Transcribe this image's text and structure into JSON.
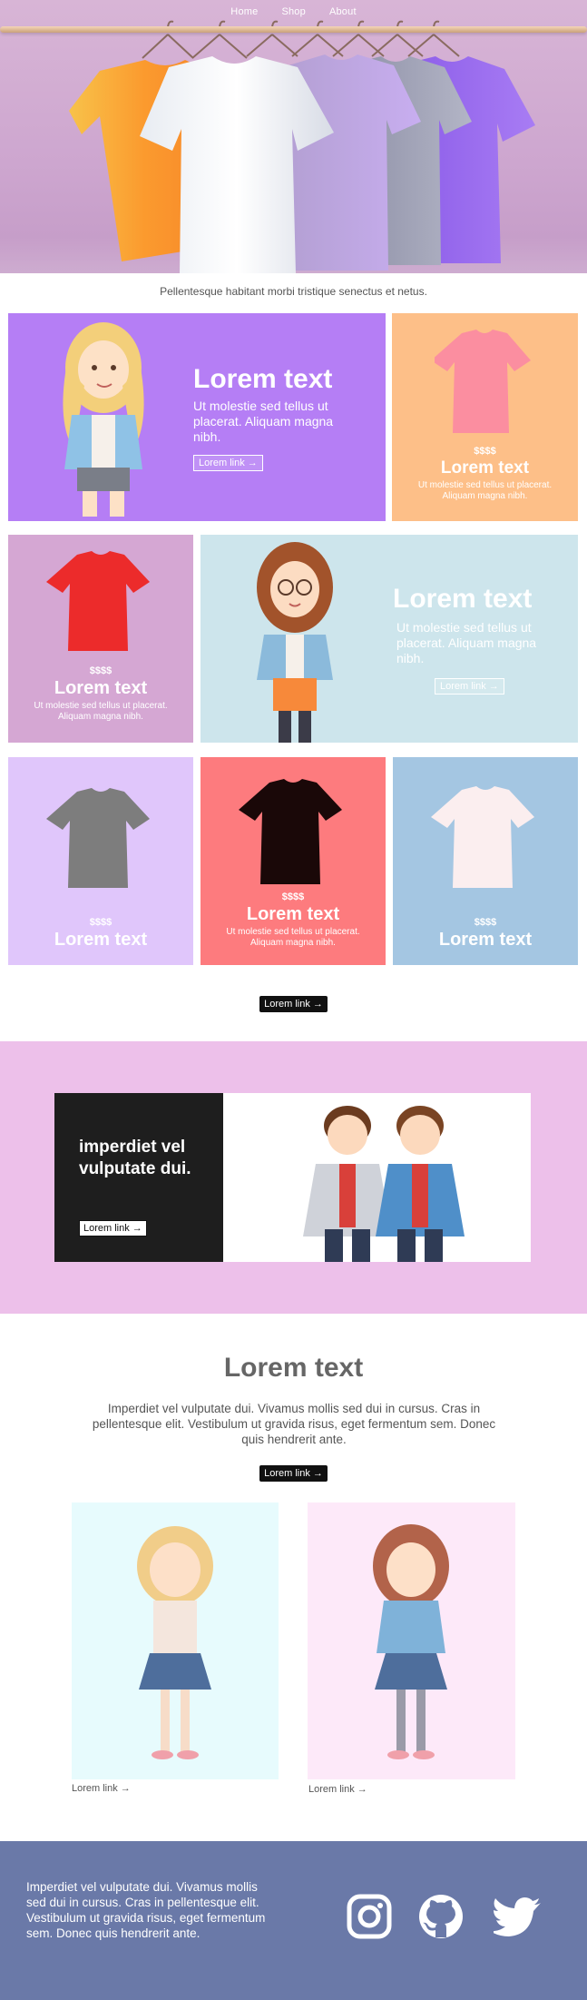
{
  "nav": {
    "items": [
      "Home",
      "Shop",
      "About"
    ]
  },
  "tagline": "Pellentesque habitant morbi tristique senectus et netus.",
  "feature_card_1": {
    "title": "Lorem text",
    "body": "Ut molestie sed tellus ut placerat. Aliquam magna nibh.",
    "link": "Lorem link →",
    "bg": "#b57ef5"
  },
  "product_card_peach": {
    "price": "$$$$",
    "title": "Lorem text",
    "body": "Ut molestie sed tellus ut placerat. Aliquam magna nibh.",
    "bg": "#fdbf88"
  },
  "product_card_red": {
    "price": "$$$$",
    "title": "Lorem text",
    "body": "Ut molestie sed tellus ut placerat. Aliquam magna nibh.",
    "bg": "#d5a7d3"
  },
  "feature_card_2": {
    "title": "Lorem text",
    "body": "Ut molestie sed tellus ut placerat. Aliquam magna nibh.",
    "link": "Lorem link →",
    "bg": "#cde5ec"
  },
  "product_card_gray": {
    "price": "$$$$",
    "title": "Lorem text",
    "bg": "#e0c6fb"
  },
  "product_card_black": {
    "price": "$$$$",
    "title": "Lorem text",
    "body": "Ut molestie sed tellus ut placerat. Aliquam magna nibh.",
    "bg": "#fd7b7e"
  },
  "product_card_white": {
    "price": "$$$$",
    "title": "Lorem text",
    "bg": "#a4c6e2"
  },
  "grid_link": "Lorem link →",
  "banner": {
    "title": "imperdiet vel vulputate dui.",
    "link": "Lorem link →"
  },
  "section": {
    "title": "Lorem text",
    "body": "Imperdiet vel vulputate dui. Vivamus mollis sed dui in cursus. Cras in pellentesque elit. Vestibulum ut gravida risus, eget fermentum sem. Donec quis hendrerit ante.",
    "link": "Lorem link →",
    "card_left_link": "Lorem link →",
    "card_right_link": "Lorem link →"
  },
  "footer": {
    "text": "Imperdiet vel vulputate dui. Vivamus mollis sed dui in cursus. Cras in pellentesque elit. Vestibulum ut gravida risus, eget fermentum sem. Donec quis hendrerit ante.",
    "icons": [
      "instagram-icon",
      "github-icon",
      "twitter-icon"
    ]
  }
}
